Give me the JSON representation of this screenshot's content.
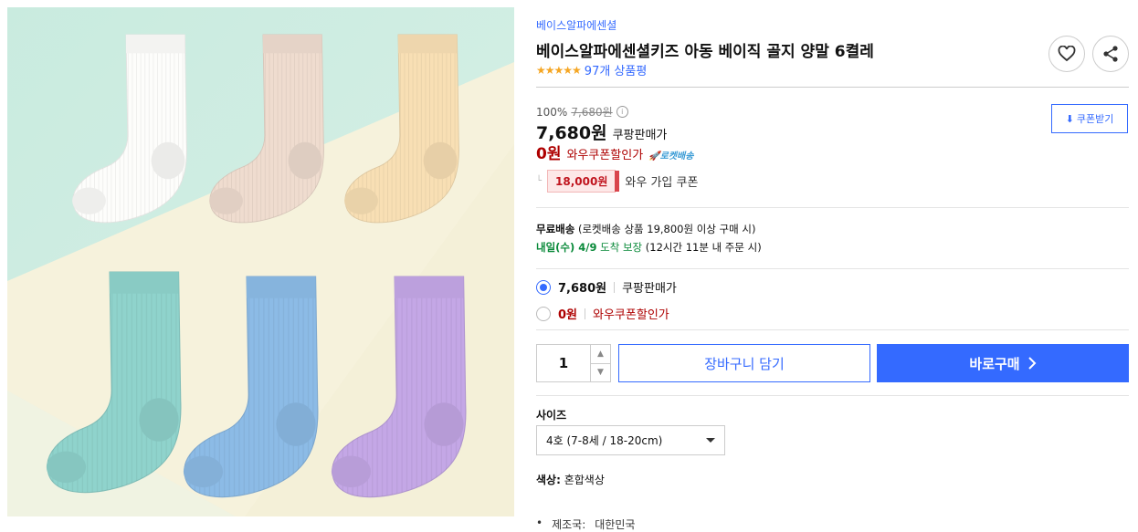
{
  "product": {
    "brand": "베이스알파에센셜",
    "title": "베이스알파에센셜키즈 아동 베이직 골지 양말 6켤레",
    "stars": "★★★★★",
    "review_count": "97개 상품평",
    "rating_value": 5
  },
  "price": {
    "discount_rate": "100%",
    "original_price": "7,680원",
    "sale_price": "7,680원",
    "sale_label": "쿠팡판매가",
    "wow_price": "0원",
    "wow_label": "와우쿠폰할인가",
    "rocket_label": "로켓배송",
    "coupon_amount": "18,000원",
    "coupon_text": "와우 가입 쿠폰",
    "coupon_button": "쿠폰받기"
  },
  "shipping": {
    "free_label": "무료배송",
    "free_detail": "(로켓배송 상품 19,800원 이상 구매 시)",
    "arrival": "내일(수) 4/9",
    "arrival_suffix": "도착 보장",
    "arrival_detail": "(12시간 11분 내 주문 시)"
  },
  "options": [
    {
      "price": "7,680원",
      "label": "쿠팡판매가",
      "selected": true
    },
    {
      "price": "0원",
      "label": "와우쿠폰할인가",
      "selected": false
    }
  ],
  "purchase": {
    "quantity": "1",
    "cart_label": "장바구니 담기",
    "buy_label": "바로구매"
  },
  "size": {
    "label": "사이즈",
    "selected": "4호 (7-8세 / 18-20cm)"
  },
  "color": {
    "label": "색상:",
    "value": "혼합색상"
  },
  "origin": {
    "label": "제조국:",
    "value": "대한민국"
  },
  "colors": {
    "accent": "#346aff",
    "wow_red": "#ae0000",
    "star": "#f5a623",
    "arrival_green": "#0a8a3a"
  },
  "image": {
    "sock_colors": [
      "#fdfdfb",
      "#efdccf",
      "#f8dfb4",
      "#8fd3cc",
      "#8cbbe6",
      "#c4a7e6"
    ]
  }
}
